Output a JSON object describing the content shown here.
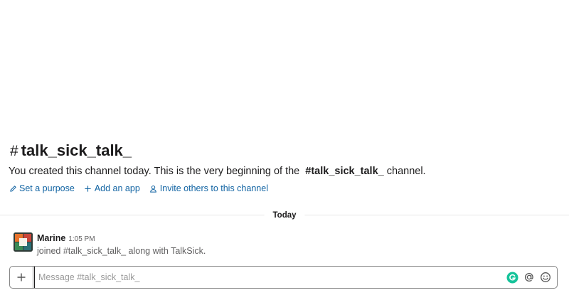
{
  "channel": {
    "hash": "#",
    "name": "talk_sick_talk_",
    "intro_prefix": "You created this channel today. This is the very beginning of the",
    "intro_channel_ref": "#talk_sick_talk_",
    "intro_suffix": "channel."
  },
  "intro_actions": [
    {
      "label": "Set a purpose",
      "icon": "pencil-icon"
    },
    {
      "label": "Add an app",
      "icon": "plus-icon"
    },
    {
      "label": "Invite others to this channel",
      "icon": "person-icon"
    }
  ],
  "day_divider": {
    "label": "Today"
  },
  "messages": [
    {
      "sender": "Marine",
      "time": "1:05 PM",
      "text": "joined #talk_sick_talk_ along with TalkSick.",
      "avatar": "avatar-icon"
    }
  ],
  "composer": {
    "placeholder": "Message #talk_sick_talk_",
    "value": "",
    "icons": [
      "plus-icon",
      "grammarly-icon",
      "at-sign-icon",
      "emoji-icon"
    ]
  },
  "colors": {
    "link": "#1264a3",
    "text": "#1d1c1d",
    "muted": "#616061",
    "grammarly": "#15c39a"
  }
}
